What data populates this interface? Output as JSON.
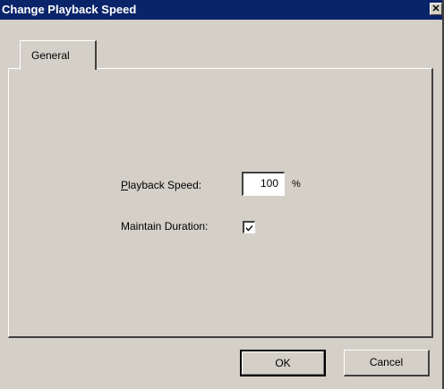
{
  "window": {
    "title": "Change Playback Speed",
    "close_glyph": "✕"
  },
  "tabs": [
    {
      "label": "General"
    }
  ],
  "form": {
    "playback_speed_label_prefix": "P",
    "playback_speed_label_rest": "layback Speed:",
    "playback_speed_value": "100",
    "playback_speed_unit": "%",
    "maintain_duration_label": "Maintain Duration:",
    "maintain_duration_checked": true
  },
  "buttons": {
    "ok_label": "OK",
    "cancel_label": "Cancel"
  },
  "colors": {
    "titlebar": "#0a246a",
    "face": "#d4d0c8"
  }
}
